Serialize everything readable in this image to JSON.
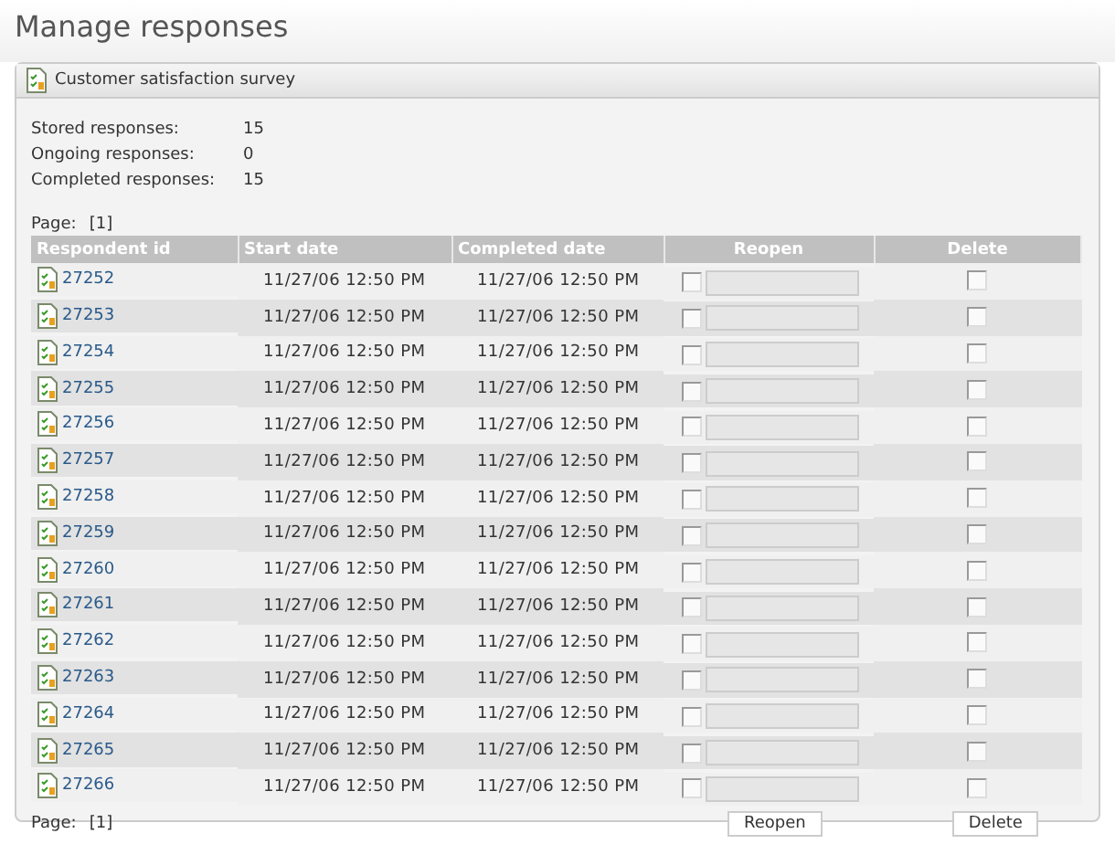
{
  "page_title": "Manage responses",
  "panel": {
    "title": "Customer satisfaction survey",
    "stats": [
      {
        "label": "Stored responses:",
        "value": "15"
      },
      {
        "label": "Ongoing responses:",
        "value": "0"
      },
      {
        "label": "Completed responses:",
        "value": "15"
      }
    ],
    "pager_top": {
      "label": "Page:",
      "pages": "[1]"
    },
    "table": {
      "columns": [
        "Respondent id",
        "Start date",
        "Completed date",
        "Reopen",
        "Delete"
      ],
      "rows": [
        {
          "id": "27252",
          "start": "11/27/06 12:50 PM",
          "completed": "11/27/06 12:50 PM",
          "reopen": false,
          "delete": false
        },
        {
          "id": "27253",
          "start": "11/27/06 12:50 PM",
          "completed": "11/27/06 12:50 PM",
          "reopen": false,
          "delete": false
        },
        {
          "id": "27254",
          "start": "11/27/06 12:50 PM",
          "completed": "11/27/06 12:50 PM",
          "reopen": false,
          "delete": false
        },
        {
          "id": "27255",
          "start": "11/27/06 12:50 PM",
          "completed": "11/27/06 12:50 PM",
          "reopen": false,
          "delete": false
        },
        {
          "id": "27256",
          "start": "11/27/06 12:50 PM",
          "completed": "11/27/06 12:50 PM",
          "reopen": false,
          "delete": false
        },
        {
          "id": "27257",
          "start": "11/27/06 12:50 PM",
          "completed": "11/27/06 12:50 PM",
          "reopen": false,
          "delete": false
        },
        {
          "id": "27258",
          "start": "11/27/06 12:50 PM",
          "completed": "11/27/06 12:50 PM",
          "reopen": false,
          "delete": false
        },
        {
          "id": "27259",
          "start": "11/27/06 12:50 PM",
          "completed": "11/27/06 12:50 PM",
          "reopen": false,
          "delete": false
        },
        {
          "id": "27260",
          "start": "11/27/06 12:50 PM",
          "completed": "11/27/06 12:50 PM",
          "reopen": false,
          "delete": false
        },
        {
          "id": "27261",
          "start": "11/27/06 12:50 PM",
          "completed": "11/27/06 12:50 PM",
          "reopen": false,
          "delete": false
        },
        {
          "id": "27262",
          "start": "11/27/06 12:50 PM",
          "completed": "11/27/06 12:50 PM",
          "reopen": false,
          "delete": false
        },
        {
          "id": "27263",
          "start": "11/27/06 12:50 PM",
          "completed": "11/27/06 12:50 PM",
          "reopen": false,
          "delete": false
        },
        {
          "id": "27264",
          "start": "11/27/06 12:50 PM",
          "completed": "11/27/06 12:50 PM",
          "reopen": false,
          "delete": false
        },
        {
          "id": "27265",
          "start": "11/27/06 12:50 PM",
          "completed": "11/27/06 12:50 PM",
          "reopen": false,
          "delete": false
        },
        {
          "id": "27266",
          "start": "11/27/06 12:50 PM",
          "completed": "11/27/06 12:50 PM",
          "reopen": false,
          "delete": false
        }
      ]
    },
    "pager_bottom": {
      "label": "Page:",
      "pages": "[1]"
    },
    "buttons": [
      "Reopen",
      "Delete"
    ]
  }
}
